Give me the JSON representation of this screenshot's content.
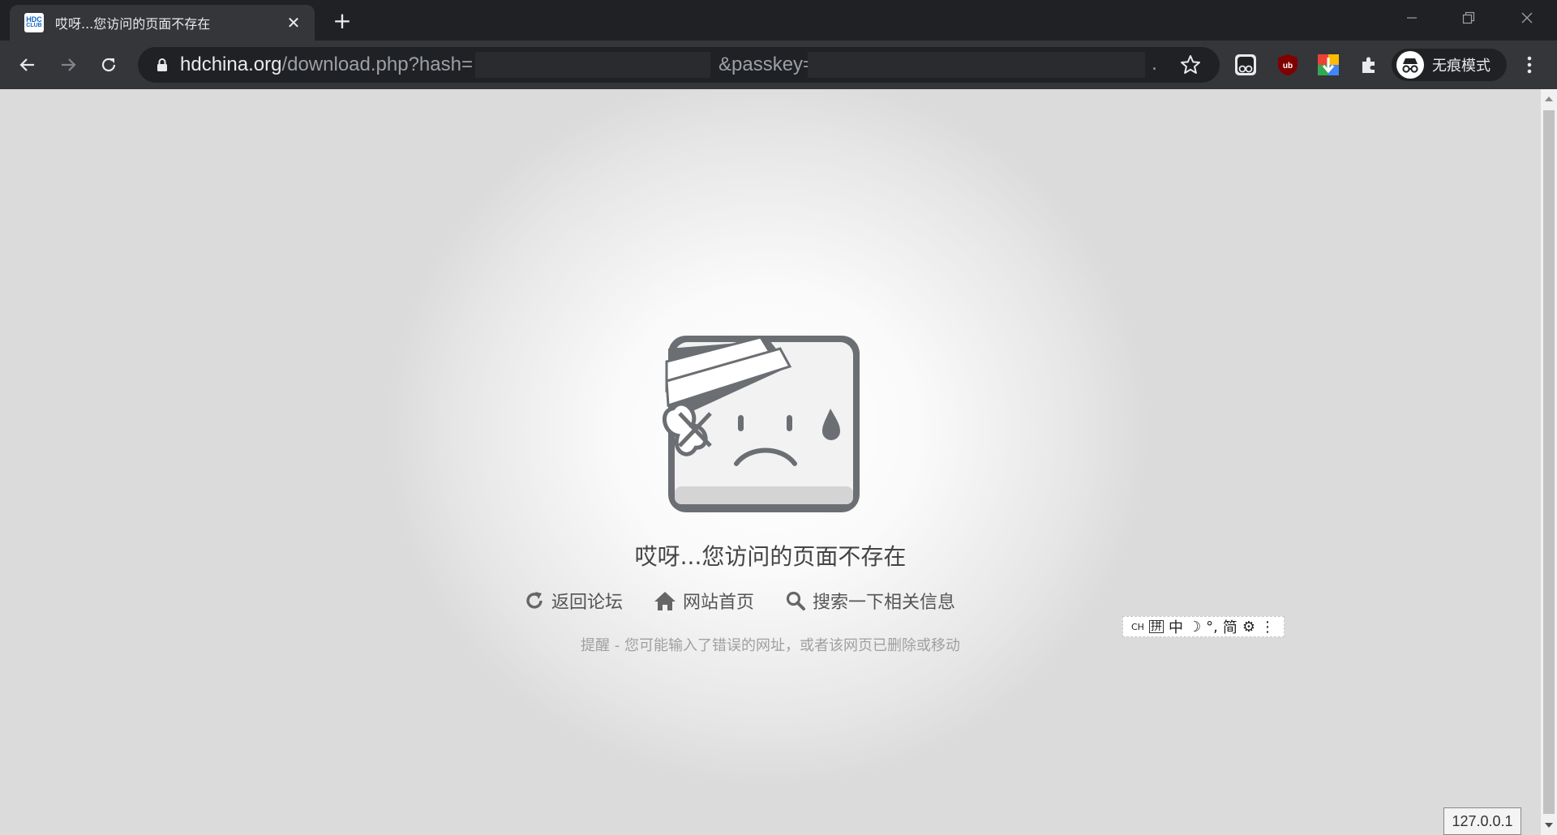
{
  "tab": {
    "title": "哎呀...您访问的页面不存在",
    "favicon_lines": [
      "HDC",
      "CLUB"
    ],
    "close_glyph": "✕",
    "new_tab_glyph": "+"
  },
  "address_bar": {
    "host": "hdchina.org",
    "path_part1": "/download.php?hash=",
    "path_part2": "&passkey=",
    "tail": "."
  },
  "profile": {
    "label": "无痕模式"
  },
  "page": {
    "title": "哎呀...您访问的页面不存在",
    "links": [
      {
        "label": "返回论坛",
        "icon": "refresh-icon"
      },
      {
        "label": "网站首页",
        "icon": "home-icon"
      },
      {
        "label": "搜索一下相关信息",
        "icon": "search-icon"
      }
    ],
    "hint": "提醒 - 您可能输入了错误的网址，或者该网页已删除或移动"
  },
  "ime_toolbar": {
    "items": [
      "CH",
      "拼",
      "中",
      "☽",
      "°,",
      "简",
      "⚙",
      "⋮"
    ]
  },
  "ip_badge": "127.0.0.1",
  "colors": {
    "chrome_dark": "#202124",
    "toolbar": "#35363a",
    "text_light": "#e8eaed",
    "icon_gray": "#6b6e72"
  }
}
